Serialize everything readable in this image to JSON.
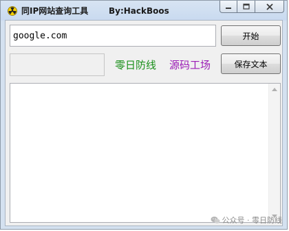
{
  "window": {
    "title": "同IP网站查询工具",
    "author": "By:HackBoos"
  },
  "icons": {
    "app": "radiation-icon",
    "minimize": "minimize-icon",
    "maximize": "maximize-icon",
    "close": "close-icon",
    "scroll_up": "scroll-up-arrow-icon",
    "scroll_down": "scroll-down-arrow-icon",
    "wechat": "wechat-icon"
  },
  "form": {
    "domain_value": "google.com",
    "start_label": "开始",
    "save_label": "保存文本",
    "status_text": ""
  },
  "links": {
    "green": "零日防线",
    "purple": "源码工场"
  },
  "colors": {
    "green_link": "#1a8f1a",
    "purple_link": "#9b1bb5"
  },
  "output": {
    "text": ""
  },
  "watermark": {
    "text": "公众号 · 零日防线"
  }
}
